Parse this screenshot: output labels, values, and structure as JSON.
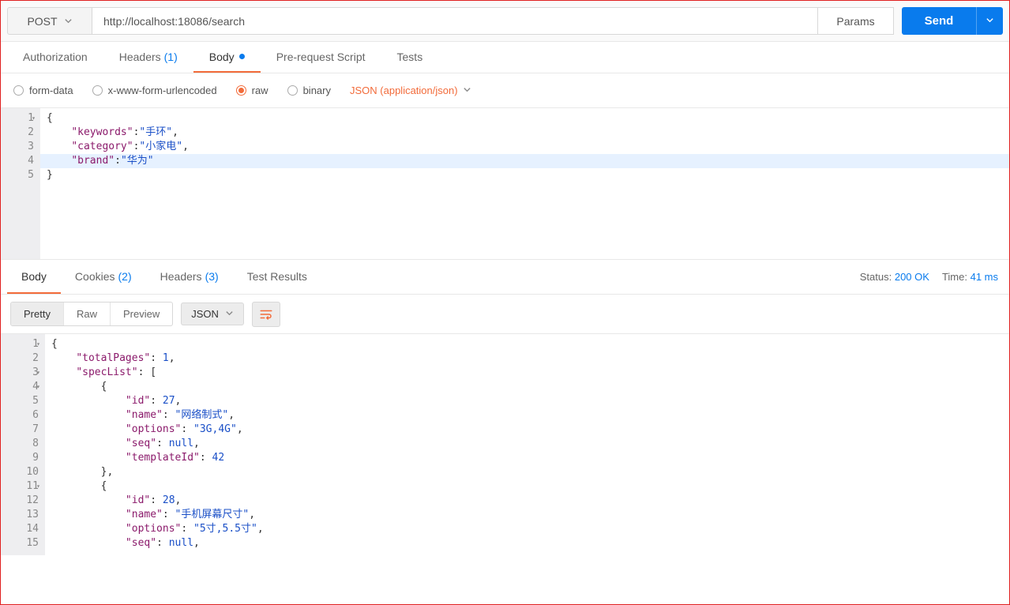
{
  "request": {
    "method": "POST",
    "url": "http://localhost:18086/search",
    "params_label": "Params",
    "send_label": "Send"
  },
  "request_tabs": {
    "authorization": "Authorization",
    "headers": "Headers",
    "headers_count": "(1)",
    "body": "Body",
    "pre_request": "Pre-request Script",
    "tests": "Tests"
  },
  "body_type": {
    "form_data": "form-data",
    "xwww": "x-www-form-urlencoded",
    "raw": "raw",
    "binary": "binary",
    "content_type": "JSON (application/json)"
  },
  "request_body_lines": [
    {
      "n": "1",
      "fold": true,
      "hl": false,
      "content": [
        {
          "t": "punc",
          "v": "{"
        }
      ]
    },
    {
      "n": "2",
      "fold": false,
      "hl": false,
      "content": [
        {
          "t": "indent",
          "v": "    "
        },
        {
          "t": "key",
          "v": "\"keywords\""
        },
        {
          "t": "punc",
          "v": ":"
        },
        {
          "t": "str",
          "v": "\"手环\""
        },
        {
          "t": "punc",
          "v": ","
        }
      ]
    },
    {
      "n": "3",
      "fold": false,
      "hl": false,
      "content": [
        {
          "t": "indent",
          "v": "    "
        },
        {
          "t": "key",
          "v": "\"category\""
        },
        {
          "t": "punc",
          "v": ":"
        },
        {
          "t": "str",
          "v": "\"小家电\""
        },
        {
          "t": "punc",
          "v": ","
        }
      ]
    },
    {
      "n": "4",
      "fold": false,
      "hl": true,
      "content": [
        {
          "t": "indent",
          "v": "    "
        },
        {
          "t": "key",
          "v": "\"brand\""
        },
        {
          "t": "punc",
          "v": ":"
        },
        {
          "t": "str",
          "v": "\"华为\""
        }
      ]
    },
    {
      "n": "5",
      "fold": false,
      "hl": false,
      "content": [
        {
          "t": "punc",
          "v": "}"
        }
      ]
    }
  ],
  "response_tabs": {
    "body": "Body",
    "cookies": "Cookies",
    "cookies_count": "(2)",
    "headers": "Headers",
    "headers_count": "(3)",
    "test_results": "Test Results"
  },
  "response_meta": {
    "status_label": "Status:",
    "status_value": "200 OK",
    "time_label": "Time:",
    "time_value": "41 ms"
  },
  "response_toolbar": {
    "pretty": "Pretty",
    "raw": "Raw",
    "preview": "Preview",
    "format": "JSON"
  },
  "response_body_lines": [
    {
      "n": "1",
      "fold": true,
      "content": [
        {
          "t": "punc",
          "v": "{"
        }
      ]
    },
    {
      "n": "2",
      "fold": false,
      "content": [
        {
          "t": "indent",
          "v": "    "
        },
        {
          "t": "key",
          "v": "\"totalPages\""
        },
        {
          "t": "punc",
          "v": ": "
        },
        {
          "t": "num",
          "v": "1"
        },
        {
          "t": "punc",
          "v": ","
        }
      ]
    },
    {
      "n": "3",
      "fold": true,
      "content": [
        {
          "t": "indent",
          "v": "    "
        },
        {
          "t": "key",
          "v": "\"specList\""
        },
        {
          "t": "punc",
          "v": ": ["
        }
      ]
    },
    {
      "n": "4",
      "fold": true,
      "content": [
        {
          "t": "indent",
          "v": "        "
        },
        {
          "t": "punc",
          "v": "{"
        }
      ]
    },
    {
      "n": "5",
      "fold": false,
      "content": [
        {
          "t": "indent",
          "v": "            "
        },
        {
          "t": "key",
          "v": "\"id\""
        },
        {
          "t": "punc",
          "v": ": "
        },
        {
          "t": "num",
          "v": "27"
        },
        {
          "t": "punc",
          "v": ","
        }
      ]
    },
    {
      "n": "6",
      "fold": false,
      "content": [
        {
          "t": "indent",
          "v": "            "
        },
        {
          "t": "key",
          "v": "\"name\""
        },
        {
          "t": "punc",
          "v": ": "
        },
        {
          "t": "str",
          "v": "\"网络制式\""
        },
        {
          "t": "punc",
          "v": ","
        }
      ]
    },
    {
      "n": "7",
      "fold": false,
      "content": [
        {
          "t": "indent",
          "v": "            "
        },
        {
          "t": "key",
          "v": "\"options\""
        },
        {
          "t": "punc",
          "v": ": "
        },
        {
          "t": "str",
          "v": "\"3G,4G\""
        },
        {
          "t": "punc",
          "v": ","
        }
      ]
    },
    {
      "n": "8",
      "fold": false,
      "content": [
        {
          "t": "indent",
          "v": "            "
        },
        {
          "t": "key",
          "v": "\"seq\""
        },
        {
          "t": "punc",
          "v": ": "
        },
        {
          "t": "null",
          "v": "null"
        },
        {
          "t": "punc",
          "v": ","
        }
      ]
    },
    {
      "n": "9",
      "fold": false,
      "content": [
        {
          "t": "indent",
          "v": "            "
        },
        {
          "t": "key",
          "v": "\"templateId\""
        },
        {
          "t": "punc",
          "v": ": "
        },
        {
          "t": "num",
          "v": "42"
        }
      ]
    },
    {
      "n": "10",
      "fold": false,
      "content": [
        {
          "t": "indent",
          "v": "        "
        },
        {
          "t": "punc",
          "v": "},"
        }
      ]
    },
    {
      "n": "11",
      "fold": true,
      "content": [
        {
          "t": "indent",
          "v": "        "
        },
        {
          "t": "punc",
          "v": "{"
        }
      ]
    },
    {
      "n": "12",
      "fold": false,
      "content": [
        {
          "t": "indent",
          "v": "            "
        },
        {
          "t": "key",
          "v": "\"id\""
        },
        {
          "t": "punc",
          "v": ": "
        },
        {
          "t": "num",
          "v": "28"
        },
        {
          "t": "punc",
          "v": ","
        }
      ]
    },
    {
      "n": "13",
      "fold": false,
      "content": [
        {
          "t": "indent",
          "v": "            "
        },
        {
          "t": "key",
          "v": "\"name\""
        },
        {
          "t": "punc",
          "v": ": "
        },
        {
          "t": "str",
          "v": "\"手机屏幕尺寸\""
        },
        {
          "t": "punc",
          "v": ","
        }
      ]
    },
    {
      "n": "14",
      "fold": false,
      "content": [
        {
          "t": "indent",
          "v": "            "
        },
        {
          "t": "key",
          "v": "\"options\""
        },
        {
          "t": "punc",
          "v": ": "
        },
        {
          "t": "str",
          "v": "\"5寸,5.5寸\""
        },
        {
          "t": "punc",
          "v": ","
        }
      ]
    },
    {
      "n": "15",
      "fold": false,
      "content": [
        {
          "t": "indent",
          "v": "            "
        },
        {
          "t": "key",
          "v": "\"seq\""
        },
        {
          "t": "punc",
          "v": ": "
        },
        {
          "t": "null",
          "v": "null"
        },
        {
          "t": "punc",
          "v": ","
        }
      ]
    }
  ]
}
